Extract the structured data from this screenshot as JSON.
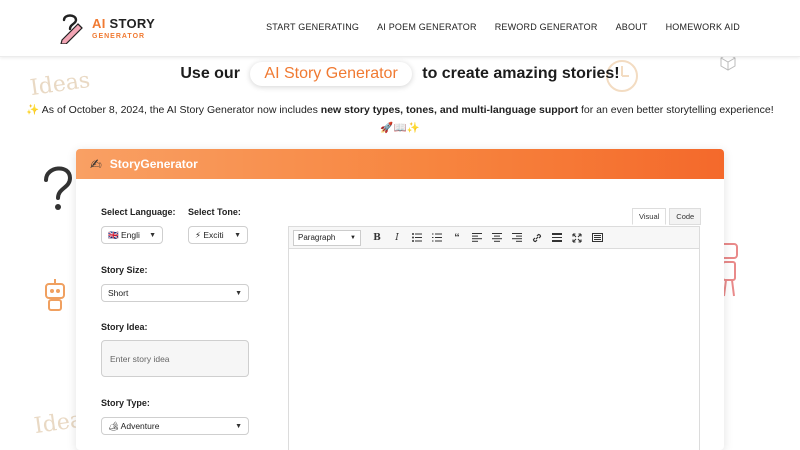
{
  "logo": {
    "title_ai": "AI",
    "title_rest": "STORY",
    "subtitle": "GENERATOR"
  },
  "nav": [
    "START GENERATING",
    "AI POEM GENERATOR",
    "REWORD GENERATOR",
    "ABOUT",
    "HOMEWORK AID"
  ],
  "hero": {
    "prefix": "Use our",
    "highlight": "AI Story Generator",
    "suffix": "to create amazing stories!"
  },
  "announcement": {
    "part1": "✨ As of October 8, 2024, the AI Story Generator now includes ",
    "bold": "new story types, tones, and multi-language support",
    "part2": " for an even better storytelling experience! 🚀📖✨"
  },
  "card": {
    "icon": "✍",
    "title": "StoryGenerator",
    "language_label": "Select Language:",
    "language_value": "🇬🇧 Engli",
    "tone_label": "Select Tone:",
    "tone_value": "⚡ Exciti",
    "size_label": "Story Size:",
    "size_value": "Short",
    "idea_label": "Story Idea:",
    "idea_placeholder": "Enter story idea",
    "type_label": "Story Type:",
    "type_value": "🏕 Adventure"
  },
  "editor": {
    "tab_visual": "Visual",
    "tab_code": "Code",
    "format_value": "Paragraph",
    "toolbar": [
      "B",
      "I",
      "≔",
      "⅓",
      "❝",
      "≡",
      "≡",
      "≡",
      "🔗",
      "▬",
      "⤧",
      "⌨"
    ]
  },
  "doodles": {
    "ideas_top": "Ideas",
    "ideas_bottom": "Ideas",
    "question": "?"
  }
}
